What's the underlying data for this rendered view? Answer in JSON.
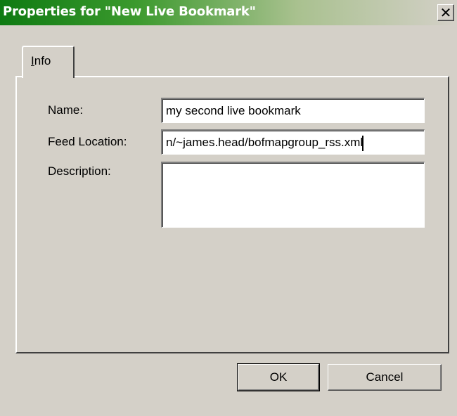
{
  "window": {
    "title": "Properties for \"New Live Bookmark\"",
    "close_glyph": "✕"
  },
  "tabs": [
    {
      "label": "Info",
      "mnemonic": "I",
      "rest": "nfo",
      "selected": true
    }
  ],
  "form": {
    "name_label": "Name:",
    "name_value": "my second live bookmark",
    "feed_label": "Feed Location:",
    "feed_value": "n/~james.head/bofmapgroup_rss.xml",
    "description_label": "Description:",
    "description_value": ""
  },
  "buttons": {
    "ok_label": "OK",
    "cancel_label": "Cancel"
  },
  "colors": {
    "title_start": "#0e7a12",
    "face": "#d4d0c8"
  }
}
